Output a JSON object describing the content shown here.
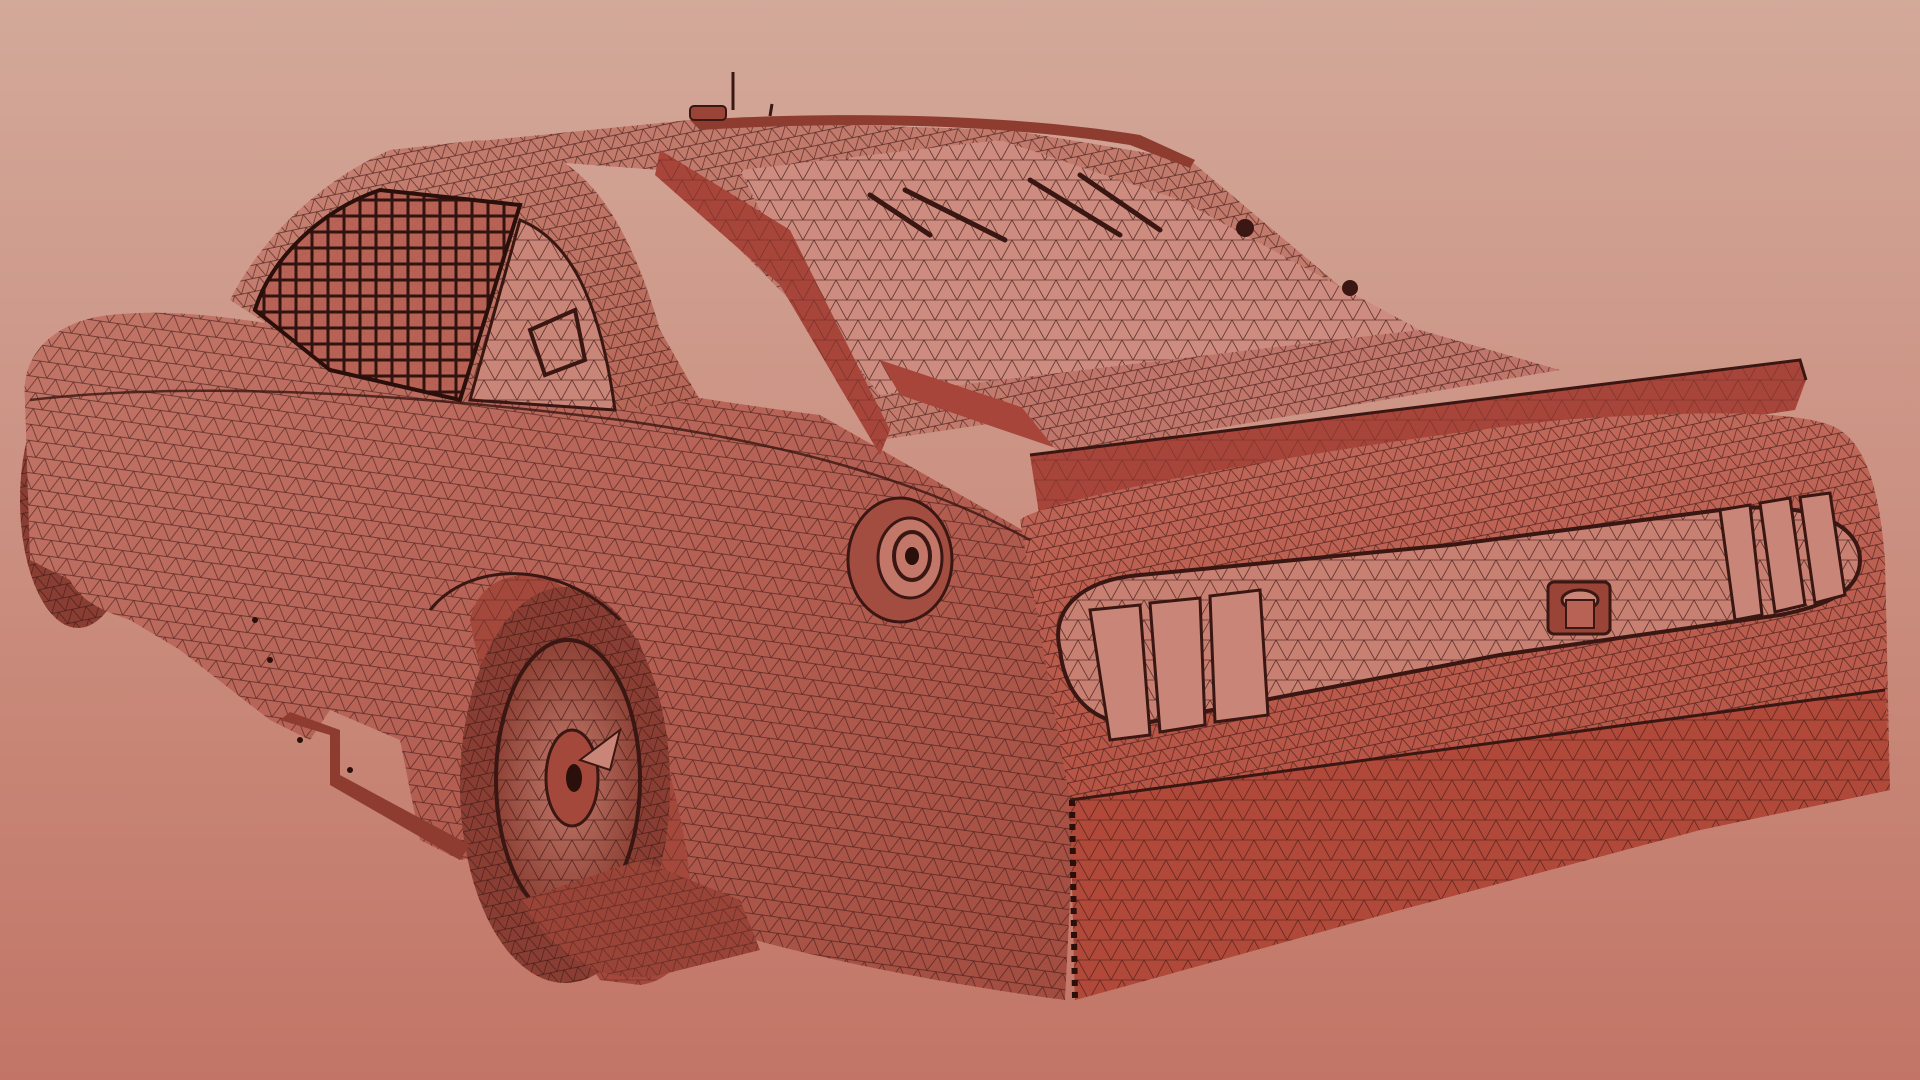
{
  "scene": {
    "subject": "stock-car-wireframe-mesh",
    "colors": {
      "background_top": "#d3a99a",
      "background_bottom": "#c27566",
      "mesh_fill": "#b86155",
      "mesh_fill_light": "#c98577",
      "mesh_fill_dark": "#9a4438",
      "panel_accent": "#a8453a",
      "wire": "#3a1712",
      "tire": "#7d3a30"
    },
    "icons": {
      "car": "car-wireframe-icon",
      "wheel": "wheel-icon",
      "spoiler": "spoiler-icon",
      "fuel_cap": "fuel-cap-icon"
    }
  }
}
